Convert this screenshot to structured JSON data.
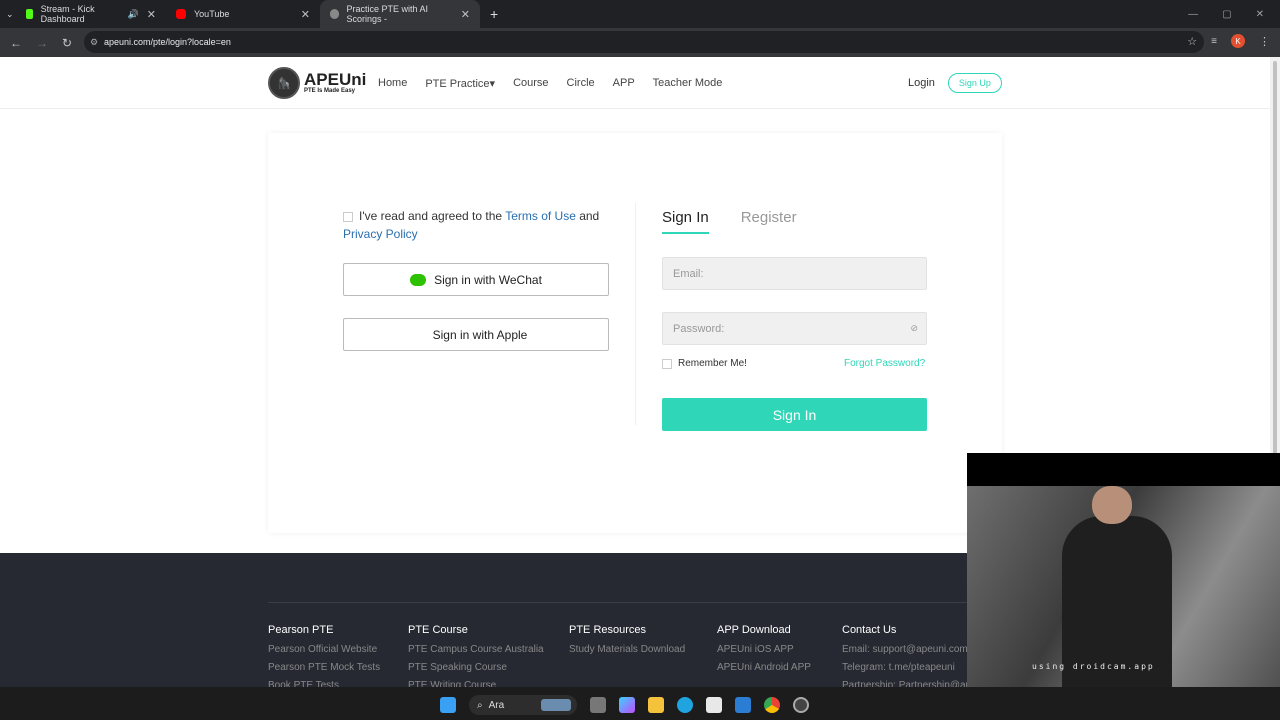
{
  "browser": {
    "tabs": [
      {
        "title": "Stream - Kick Dashboard"
      },
      {
        "title": "YouTube"
      },
      {
        "title": "Practice PTE with AI Scorings -"
      }
    ],
    "url": "apeuni.com/pte/login?locale=en",
    "avatar_letter": "K"
  },
  "header": {
    "logo_text": "APEUni",
    "logo_sub": "PTE Is Made Easy",
    "nav": [
      "Home",
      "PTE Practice▾",
      "Course",
      "Circle",
      "APP",
      "Teacher Mode"
    ],
    "login": "Login",
    "signup": "Sign Up"
  },
  "login": {
    "agree_prefix": "I've read and agreed to the ",
    "terms": "Terms of Use",
    "agree_and": " and",
    "privacy": "Privacy Policy",
    "wechat": "Sign in with WeChat",
    "apple": "Sign in with Apple",
    "tab_signin": "Sign In",
    "tab_register": "Register",
    "email_placeholder": "Email:",
    "password_placeholder": "Password:",
    "remember": "Remember Me!",
    "forgot": "Forgot Password?",
    "submit": "Sign In"
  },
  "footer": {
    "cols": [
      {
        "title": "Pearson PTE",
        "items": [
          "Pearson Official Website",
          "Pearson PTE Mock Tests",
          "Book PTE Tests"
        ]
      },
      {
        "title": "PTE Course",
        "items": [
          "PTE Campus Course Australia",
          "PTE Speaking Course",
          "PTE Writing Course"
        ]
      },
      {
        "title": "PTE Resources",
        "items": [
          "Study Materials Download"
        ]
      },
      {
        "title": "APP Download",
        "items": [
          "APEUni iOS APP",
          "APEUni Android APP"
        ]
      },
      {
        "title": "Contact Us",
        "items": [
          "Email: support@apeuni.com",
          "Telegram: t.me/pteapeuni",
          "Partnership: Partnership@ape"
        ]
      }
    ]
  },
  "webcam": {
    "overlay": "using droidcam.app"
  },
  "taskbar": {
    "search_text": "Ara"
  },
  "colors": {
    "accent": "#2fd6b7",
    "footer_bg": "#262932"
  }
}
